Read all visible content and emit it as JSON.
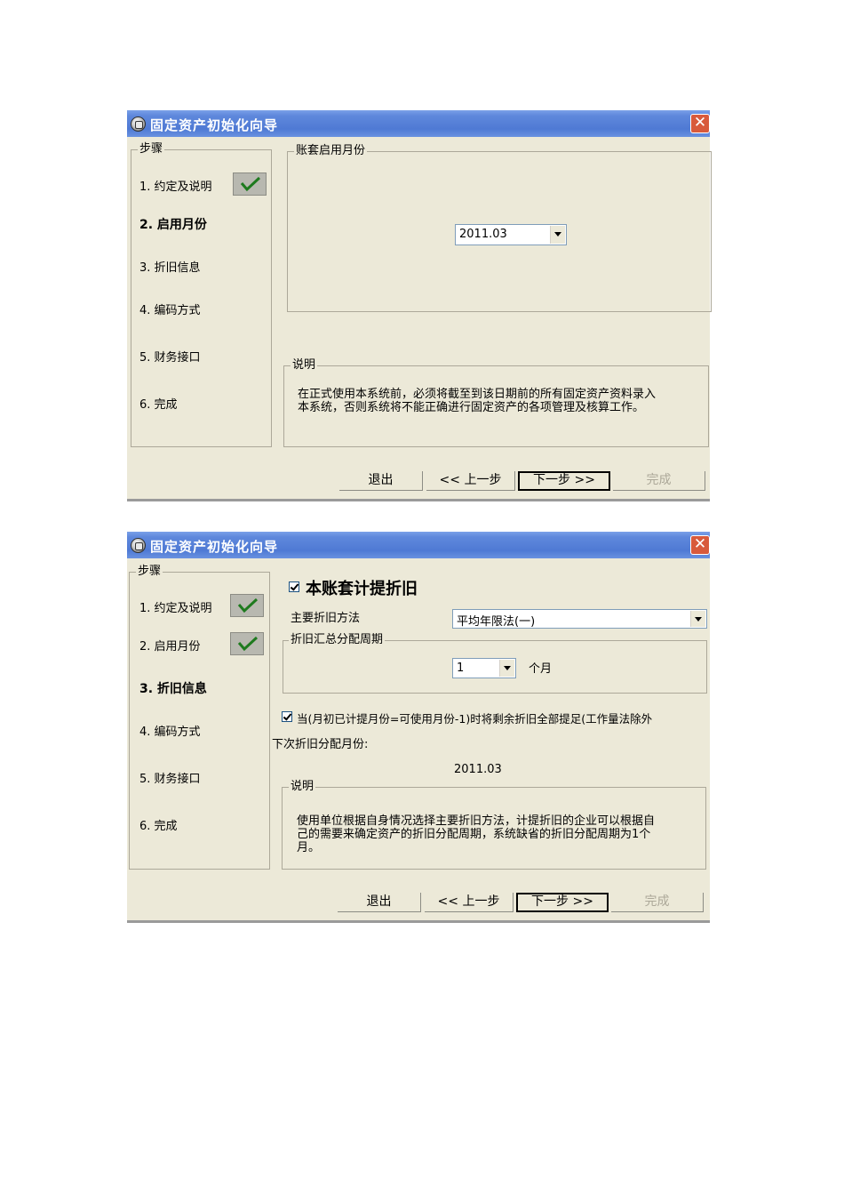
{
  "dialog1": {
    "title": "固定资产初始化向导",
    "close_glyph": "✕",
    "steps_legend": "步骤",
    "steps": [
      {
        "label": "1. 约定及说明",
        "done": true
      },
      {
        "label": "2. 启用月份",
        "active": true
      },
      {
        "label": "3. 折旧信息"
      },
      {
        "label": "4. 编码方式"
      },
      {
        "label": "5. 财务接口"
      },
      {
        "label": "6. 完成"
      }
    ],
    "month_legend": "账套启用月份",
    "month_value": "2011.03",
    "desc_legend": "说明",
    "desc_line1": "在正式使用本系统前，必须将截至到该日期前的所有固定资产资料录入",
    "desc_line2": "本系统，否则系统将不能正确进行固定资产的各项管理及核算工作。",
    "buttons": {
      "exit": "退出",
      "prev": "<< 上一步",
      "next": "下一步 >>",
      "finish": "完成"
    }
  },
  "dialog2": {
    "title": "固定资产初始化向导",
    "close_glyph": "✕",
    "steps_legend": "步骤",
    "steps": [
      {
        "label": "1. 约定及说明",
        "done": true
      },
      {
        "label": "2. 启用月份",
        "done": true
      },
      {
        "label": "3. 折旧信息",
        "active": true
      },
      {
        "label": "4. 编码方式"
      },
      {
        "label": "5. 财务接口"
      },
      {
        "label": "6. 完成"
      }
    ],
    "depr_checkbox_label": "本账套计提折旧",
    "method_label": "主要折旧方法",
    "method_value": "平均年限法(一)",
    "period_legend": "折旧汇总分配周期",
    "period_value": "1",
    "period_unit": "个月",
    "full_depr_label": "当(月初已计提月份=可使用月份-1)时将剩余折旧全部提足(工作量法除外",
    "next_alloc_label": "下次折旧分配月份:",
    "next_alloc_value": "2011.03",
    "desc_legend": "说明",
    "desc_line1": "使用单位根据自身情况选择主要折旧方法，计提折旧的企业可以根据自",
    "desc_line2": "己的需要来确定资产的折旧分配周期，系统缺省的折旧分配周期为1个",
    "desc_line3": "月。",
    "buttons": {
      "exit": "退出",
      "prev": "<< 上一步",
      "next": "下一步 >>",
      "finish": "完成"
    }
  }
}
